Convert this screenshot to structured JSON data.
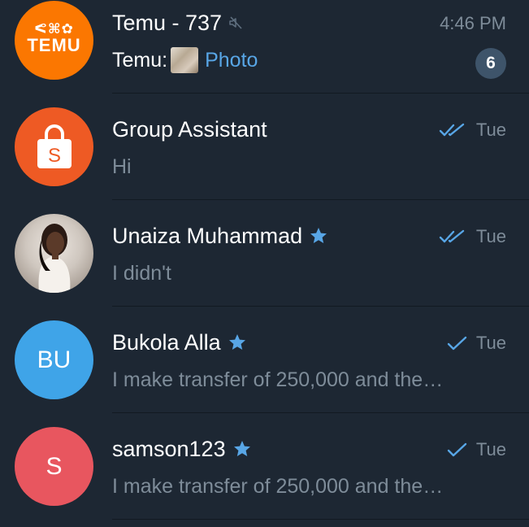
{
  "colors": {
    "background": "#1d2733",
    "name_text": "#ffffff",
    "secondary_text": "#7e8c99",
    "accent_blue": "#58a6e6",
    "badge": "#3e546a",
    "temu_orange": "#fb7701",
    "shop_orange": "#ee5a24",
    "avatar_blue": "#3fa4e8",
    "avatar_red": "#e8565f"
  },
  "chats": [
    {
      "name": "Temu - 737",
      "time": "4:46 PM",
      "sender": "Temu:",
      "media_label": "Photo",
      "unread": "6",
      "muted": true,
      "avatar": {
        "kind": "logo",
        "icon": "temu-logo-icon",
        "glyphs": "ᕙ⌘✿",
        "logo_text": "TEMU"
      }
    },
    {
      "name": "Group Assistant",
      "time": "Tue",
      "preview": "Hi",
      "status": "read-double-check",
      "avatar": {
        "kind": "icon",
        "icon": "shopping-bag-icon",
        "letter": "S"
      }
    },
    {
      "name": "Unaiza Muhammad",
      "time": "Tue",
      "preview": "I didn't",
      "status": "read-double-check",
      "starred": true,
      "avatar": {
        "kind": "photo",
        "icon": "profile-photo"
      }
    },
    {
      "name": "Bukola Alla",
      "time": "Tue",
      "preview": "I make transfer of 250,000 and the…",
      "status": "sent-single-check",
      "starred": true,
      "avatar": {
        "kind": "initials",
        "initials": "BU"
      }
    },
    {
      "name": "samson123",
      "time": "Tue",
      "preview": "I make transfer of 250,000 and the…",
      "status": "sent-single-check",
      "starred": true,
      "avatar": {
        "kind": "initials",
        "initials": "S"
      }
    }
  ]
}
